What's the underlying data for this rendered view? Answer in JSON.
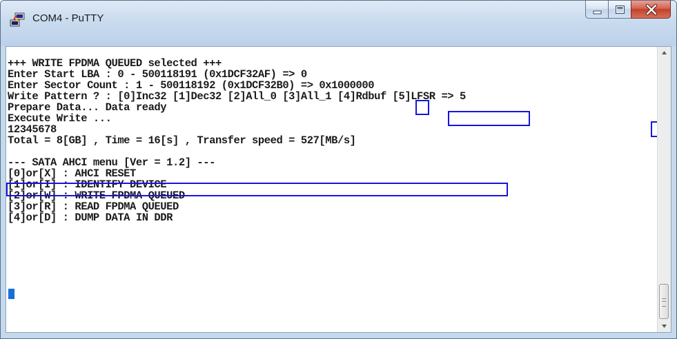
{
  "window": {
    "title": "COM4 - PuTTY",
    "icon": "putty-icon"
  },
  "caption_buttons": {
    "minimize_icon": "minimize-icon",
    "maximize_icon": "maximize-icon",
    "close_icon": "close-icon"
  },
  "terminal": {
    "lines": [
      "+++ WRITE FPDMA QUEUED selected +++",
      "Enter Start LBA : 0 - 500118191 (0x1DCF32AF) => 0",
      "Enter Sector Count : 1 - 500118192 (0x1DCF32B0) => 0x1000000",
      "Write Pattern ? : [0]Inc32 [1]Dec32 [2]All_0 [3]All_1 [4]Rdbuf [5]LFSR => 5",
      "Prepare Data... Data ready",
      "Execute Write ...",
      "12345678",
      "Total = 8[GB] , Time = 16[s] , Transfer speed = 527[MB/s]",
      "",
      "--- SATA AHCI menu [Ver = 1.2] ---",
      "[0]or[X] : AHCI RESET",
      "[1]or[I] : IDENTIFY DEVICE",
      "[2]or[W] : WRITE FPDMA QUEUED",
      "[3]or[R] : READ FPDMA QUEUED",
      "[4]or[D] : DUMP DATA IN DDR"
    ],
    "highlight_color": "#1414e0",
    "cursor_color": "#1a6ed8"
  },
  "scrollbar": {
    "up_icon": "scroll-up-arrow-icon",
    "down_icon": "scroll-down-arrow-icon"
  }
}
